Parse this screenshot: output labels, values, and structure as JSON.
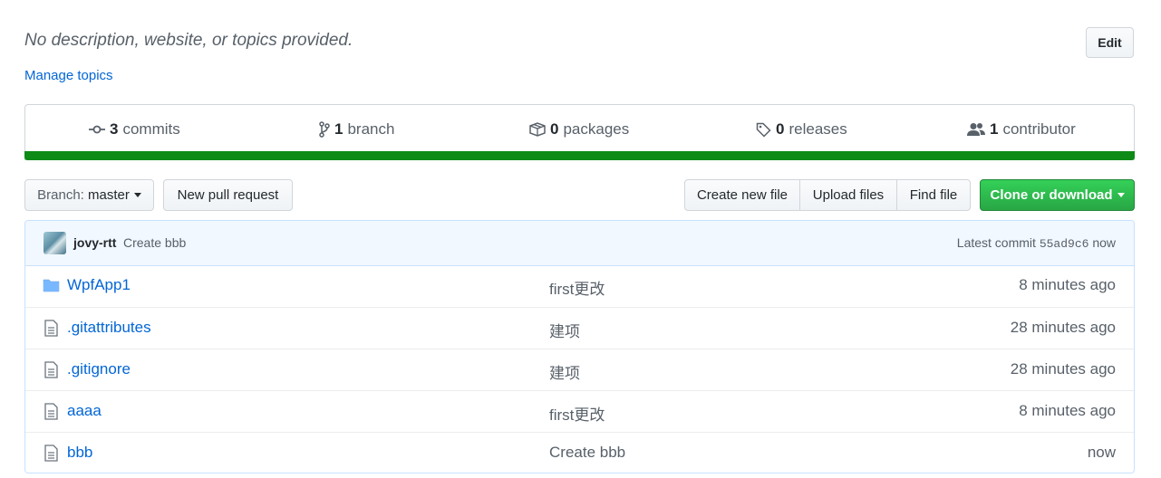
{
  "repo": {
    "description": "No description, website, or topics provided.",
    "manage_topics": "Manage topics",
    "edit_label": "Edit"
  },
  "summary": {
    "commits_count": "3",
    "commits_label": "commits",
    "branches_count": "1",
    "branches_label": "branch",
    "packages_count": "0",
    "packages_label": "packages",
    "releases_count": "0",
    "releases_label": "releases",
    "contributors_count": "1",
    "contributors_label": "contributor",
    "language_bar_color": "#0e8a16"
  },
  "toolbar": {
    "branch_prefix": "Branch:",
    "branch_name": "master",
    "new_pull_request": "New pull request",
    "create_new_file": "Create new file",
    "upload_files": "Upload files",
    "find_file": "Find file",
    "clone_or_download": "Clone or download",
    "clone_color": "#28a745"
  },
  "latest_commit": {
    "author": "jovy-rtt",
    "message": "Create bbb",
    "label": "Latest commit",
    "sha": "55ad9c6",
    "time": "now"
  },
  "files": [
    {
      "name": "WpfApp1",
      "icon": "folder-icon",
      "message": "first更改",
      "age": "8 minutes ago"
    },
    {
      "name": ".gitattributes",
      "icon": "file-icon",
      "message": "建项",
      "age": "28 minutes ago"
    },
    {
      "name": ".gitignore",
      "icon": "file-icon",
      "message": "建项",
      "age": "28 minutes ago"
    },
    {
      "name": "aaaa",
      "icon": "file-icon",
      "message": "first更改",
      "age": "8 minutes ago"
    },
    {
      "name": "bbb",
      "icon": "file-icon",
      "message": "Create bbb",
      "age": "now"
    }
  ]
}
